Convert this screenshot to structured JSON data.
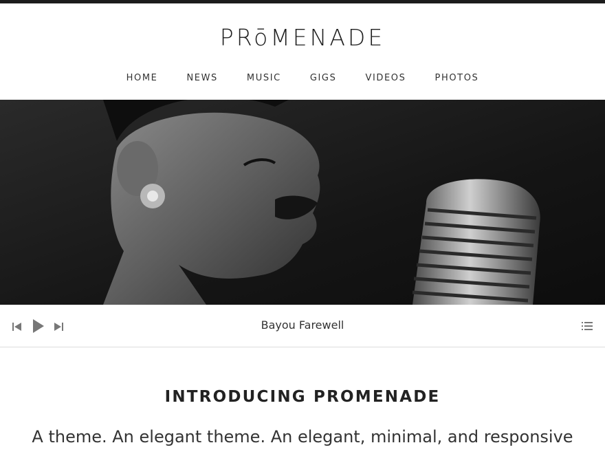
{
  "site": {
    "title": "PRōMENADE"
  },
  "nav": {
    "items": [
      {
        "label": "HOME"
      },
      {
        "label": "NEWS"
      },
      {
        "label": "MUSIC"
      },
      {
        "label": "GIGS"
      },
      {
        "label": "VIDEOS"
      },
      {
        "label": "PHOTOS"
      }
    ]
  },
  "hero": {
    "image": "black-and-white photo of a singer at a vintage microphone"
  },
  "player": {
    "track_title": "Bayou Farewell",
    "icons": [
      "previous-track-icon",
      "play-icon",
      "next-track-icon",
      "playlist-icon"
    ]
  },
  "content": {
    "heading": "INTRODUCING PROMENADE",
    "intro": "A theme. An elegant theme. An elegant, minimal, and responsive"
  },
  "colors": {
    "text": "#222222",
    "top_bar": "#1c1c1c",
    "player_icons": "#777777",
    "divider": "#dcdcdc"
  }
}
